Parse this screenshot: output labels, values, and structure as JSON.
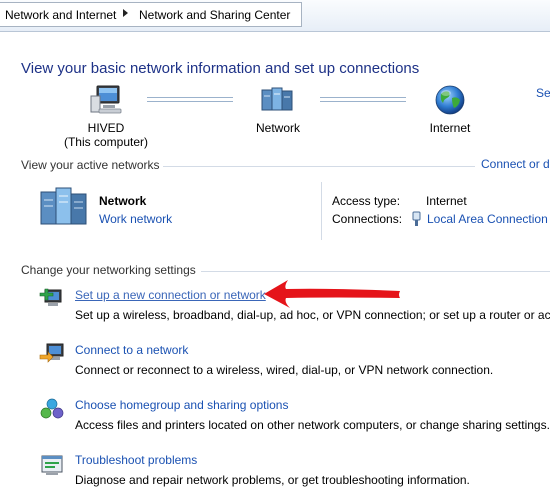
{
  "breadcrumb": {
    "items": [
      "Network and Internet",
      "Network and Sharing Center"
    ]
  },
  "heading": "View your basic network information and set up connections",
  "see_link": "Se",
  "map": {
    "computer": {
      "name": "HIVED",
      "sub": "(This computer)",
      "icon": "computer-icon"
    },
    "network": {
      "name": "Network",
      "icon": "network-icon"
    },
    "internet": {
      "name": "Internet",
      "icon": "globe-icon"
    }
  },
  "active_networks": {
    "title": "View your active networks",
    "connect_link": "Connect or d",
    "network_name": "Network",
    "network_type": "Work network",
    "access_type_label": "Access type:",
    "access_type_value": "Internet",
    "connections_label": "Connections:",
    "connections_value": "Local Area Connection"
  },
  "settings": {
    "title": "Change your networking settings",
    "tasks": [
      {
        "icon": "new-connection-icon",
        "label": "Set up a new connection or network",
        "desc": "Set up a wireless, broadband, dial-up, ad hoc, or VPN connection; or set up a router or acce"
      },
      {
        "icon": "connect-network-icon",
        "label": "Connect to a network",
        "desc": "Connect or reconnect to a wireless, wired, dial-up, or VPN network connection."
      },
      {
        "icon": "homegroup-icon",
        "label": "Choose homegroup and sharing options",
        "desc": "Access files and printers located on other network computers, or change sharing settings."
      },
      {
        "icon": "troubleshoot-icon",
        "label": "Troubleshoot problems",
        "desc": "Diagnose and repair network problems, or get troubleshooting information."
      }
    ]
  },
  "colors": {
    "link": "#1a51b2",
    "heading": "#1e3287",
    "annotation_arrow": "#e5141a"
  }
}
